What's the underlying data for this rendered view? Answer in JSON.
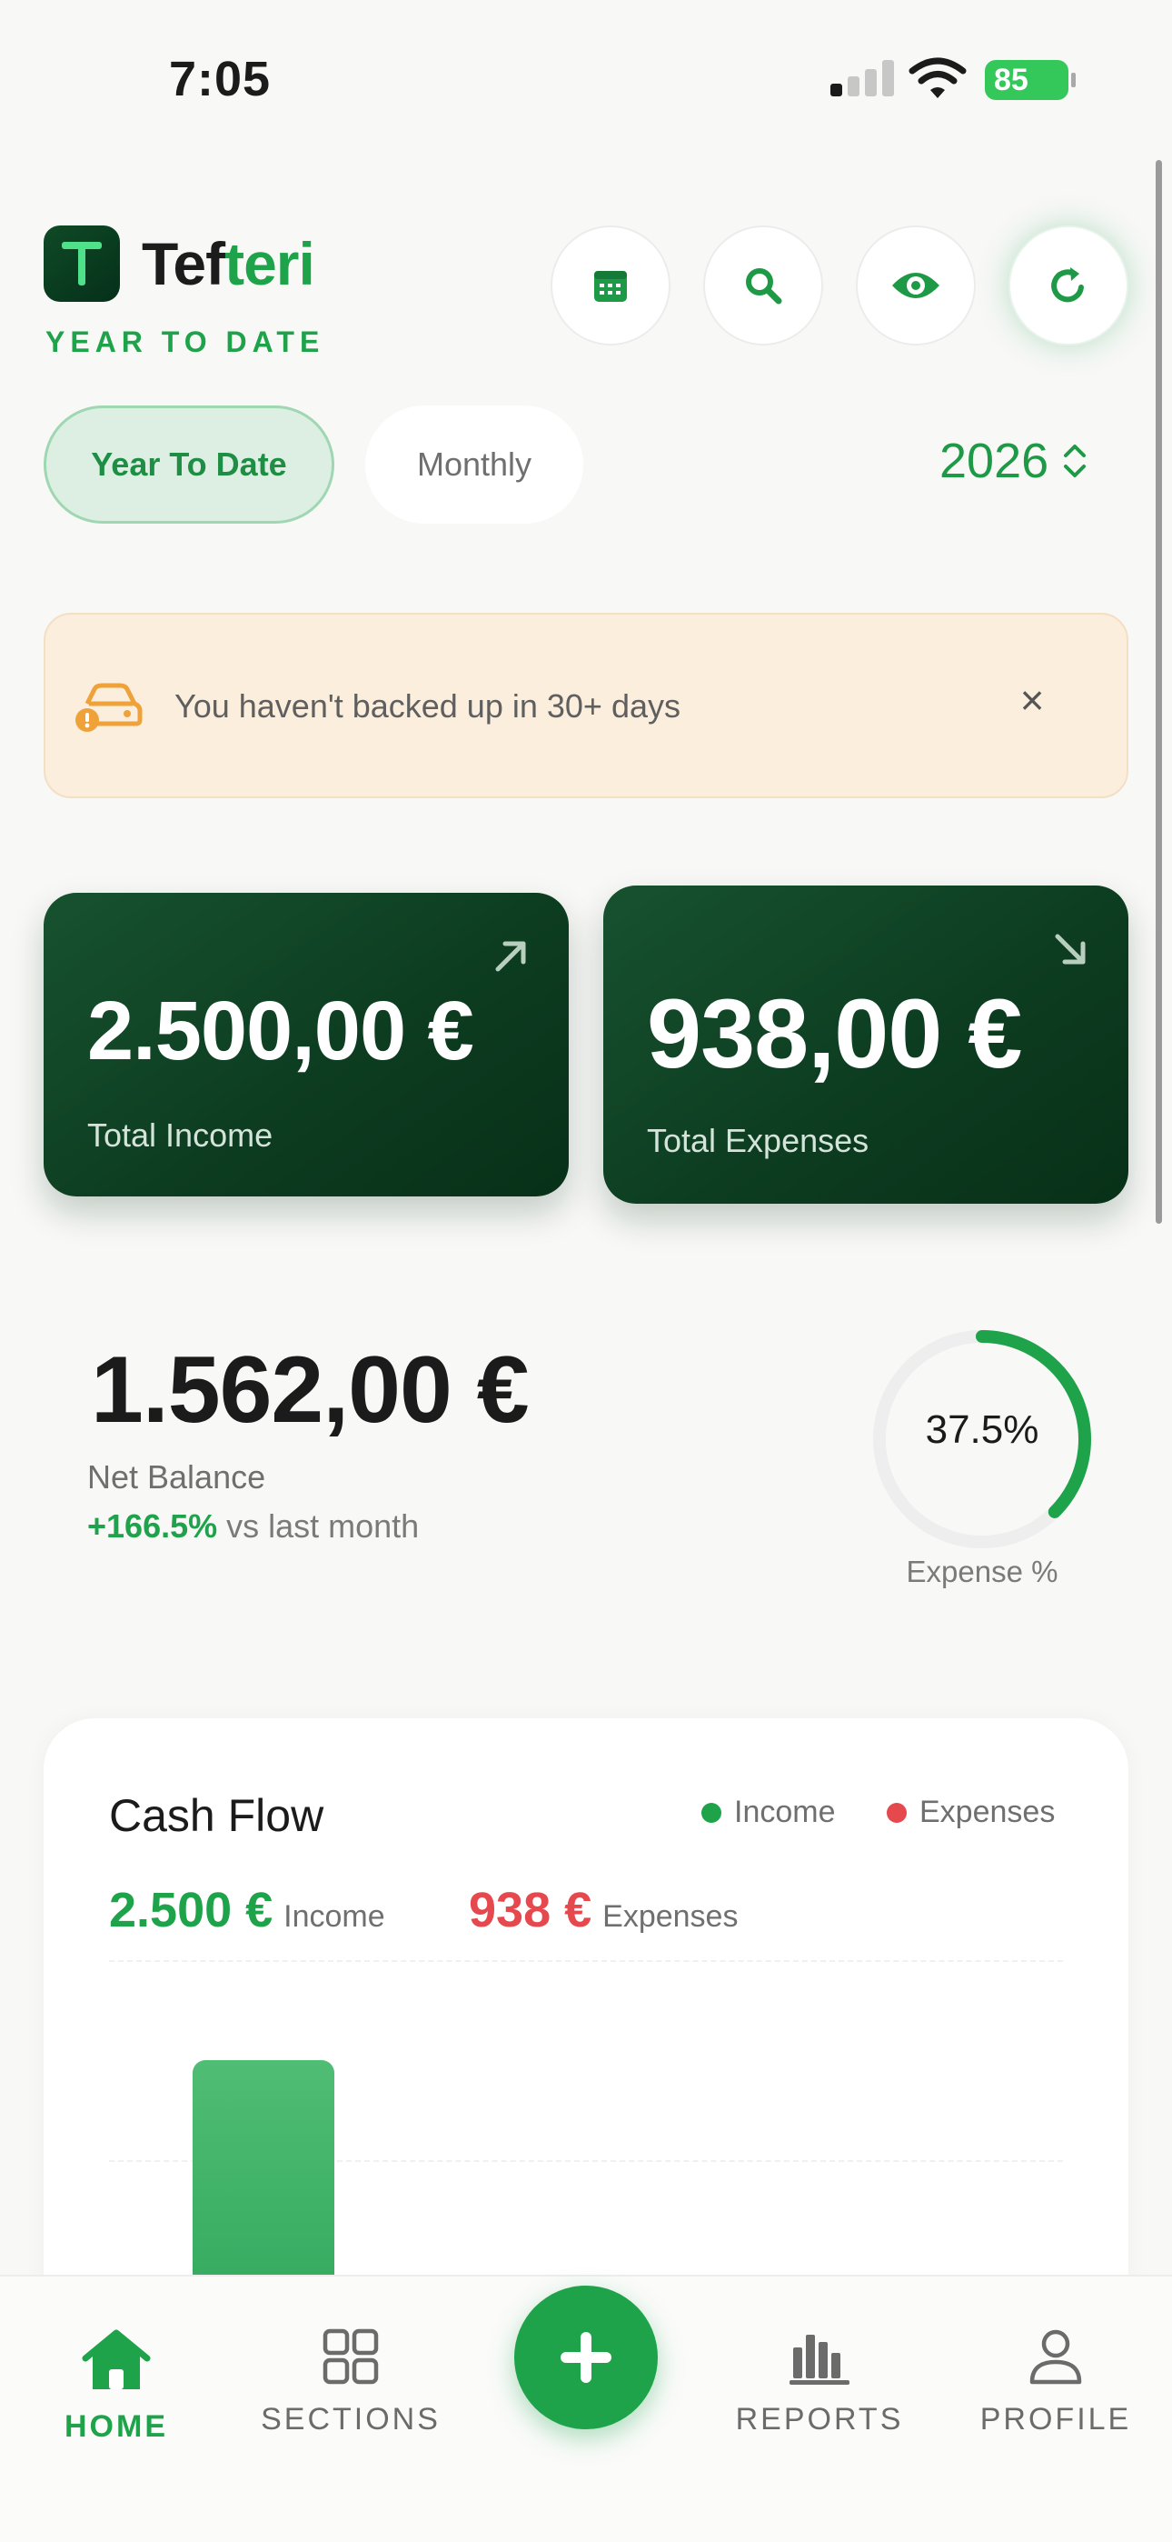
{
  "status_bar": {
    "time": "7:05",
    "battery": "85"
  },
  "header": {
    "brand_prefix": "Tef",
    "brand_suffix": "teri",
    "subtitle": "YEAR TO DATE",
    "icons": [
      "calendar-icon",
      "search-icon",
      "eye-icon",
      "refresh-icon"
    ]
  },
  "period": {
    "options": [
      "Year To Date",
      "Monthly"
    ],
    "selected": "Year To Date",
    "year": "2026"
  },
  "banner": {
    "text": "You haven't backed up in 30+ days",
    "close": "×"
  },
  "totals": {
    "income": {
      "amount": "2.500,00 €",
      "label": "Total Income"
    },
    "expenses": {
      "amount": "938,00 €",
      "label": "Total Expenses"
    }
  },
  "net": {
    "amount": "1.562,00 €",
    "label": "Net Balance",
    "change_pct": "+166.5%",
    "change_suffix": " vs last month",
    "expense_pct_text": "37.5%",
    "expense_pct_value": 37.5,
    "expense_label": "Expense %"
  },
  "cash_flow": {
    "title": "Cash Flow",
    "legend": [
      {
        "name": "Income",
        "color": "#1ea34a"
      },
      {
        "name": "Expenses",
        "color": "#e5484d"
      }
    ],
    "income_value": "2.500 €",
    "income_label": "Income",
    "expense_value": "938 €",
    "expense_label": "Expenses"
  },
  "nav": {
    "items": [
      "HOME",
      "SECTIONS",
      "REPORTS",
      "PROFILE"
    ],
    "active": "HOME"
  },
  "colors": {
    "accent": "#1ea34a",
    "card_dark": "#0d3d21",
    "expense_red": "#e5484d",
    "banner_bg": "#fbeedd"
  }
}
